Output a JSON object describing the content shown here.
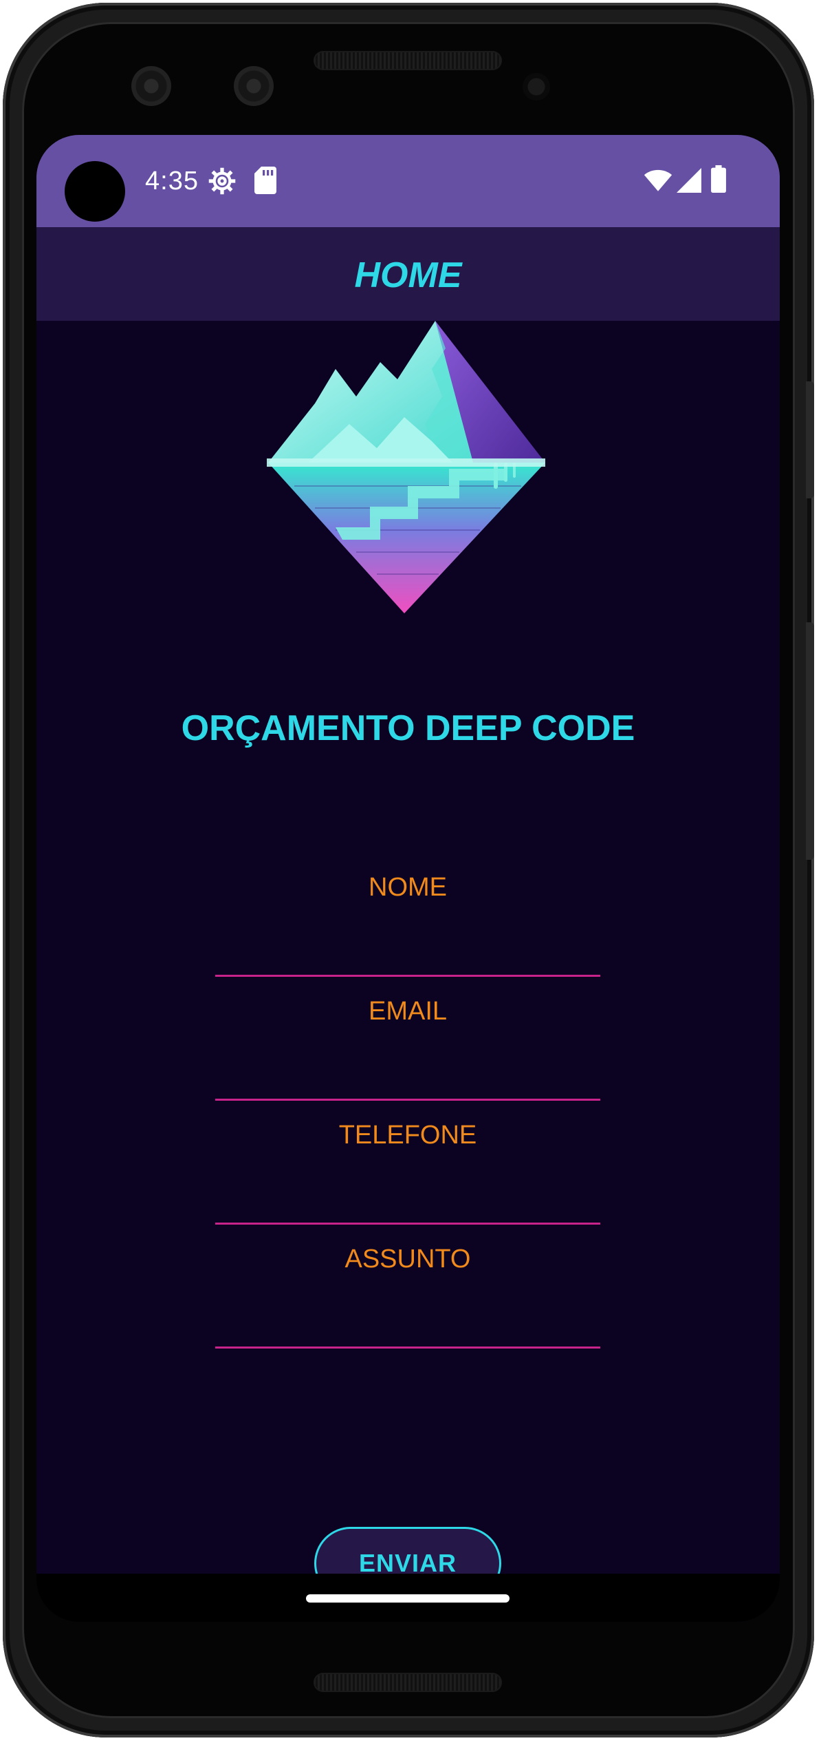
{
  "status_bar": {
    "time": "4:35",
    "icons": [
      "settings-gear-icon",
      "sd-card-icon",
      "wifi-icon",
      "cellular-signal-icon",
      "battery-icon"
    ],
    "background": "#6650a4"
  },
  "app_bar": {
    "title": "HOME",
    "background": "#251748",
    "title_color": "#2fd8e6"
  },
  "logo": {
    "icon": "mountain-diamond-logo-icon"
  },
  "main": {
    "heading": "ORÇAMENTO DEEP CODE",
    "fields": [
      {
        "label": "NOME",
        "value": ""
      },
      {
        "label": "EMAIL",
        "value": ""
      },
      {
        "label": "TELEFONE",
        "value": ""
      },
      {
        "label": "ASSUNTO",
        "value": ""
      }
    ],
    "label_color": "#f08a1c",
    "underline_color": "#c8238a",
    "background": "#0c0322"
  },
  "actions": {
    "send_label": "ENVIAR"
  }
}
